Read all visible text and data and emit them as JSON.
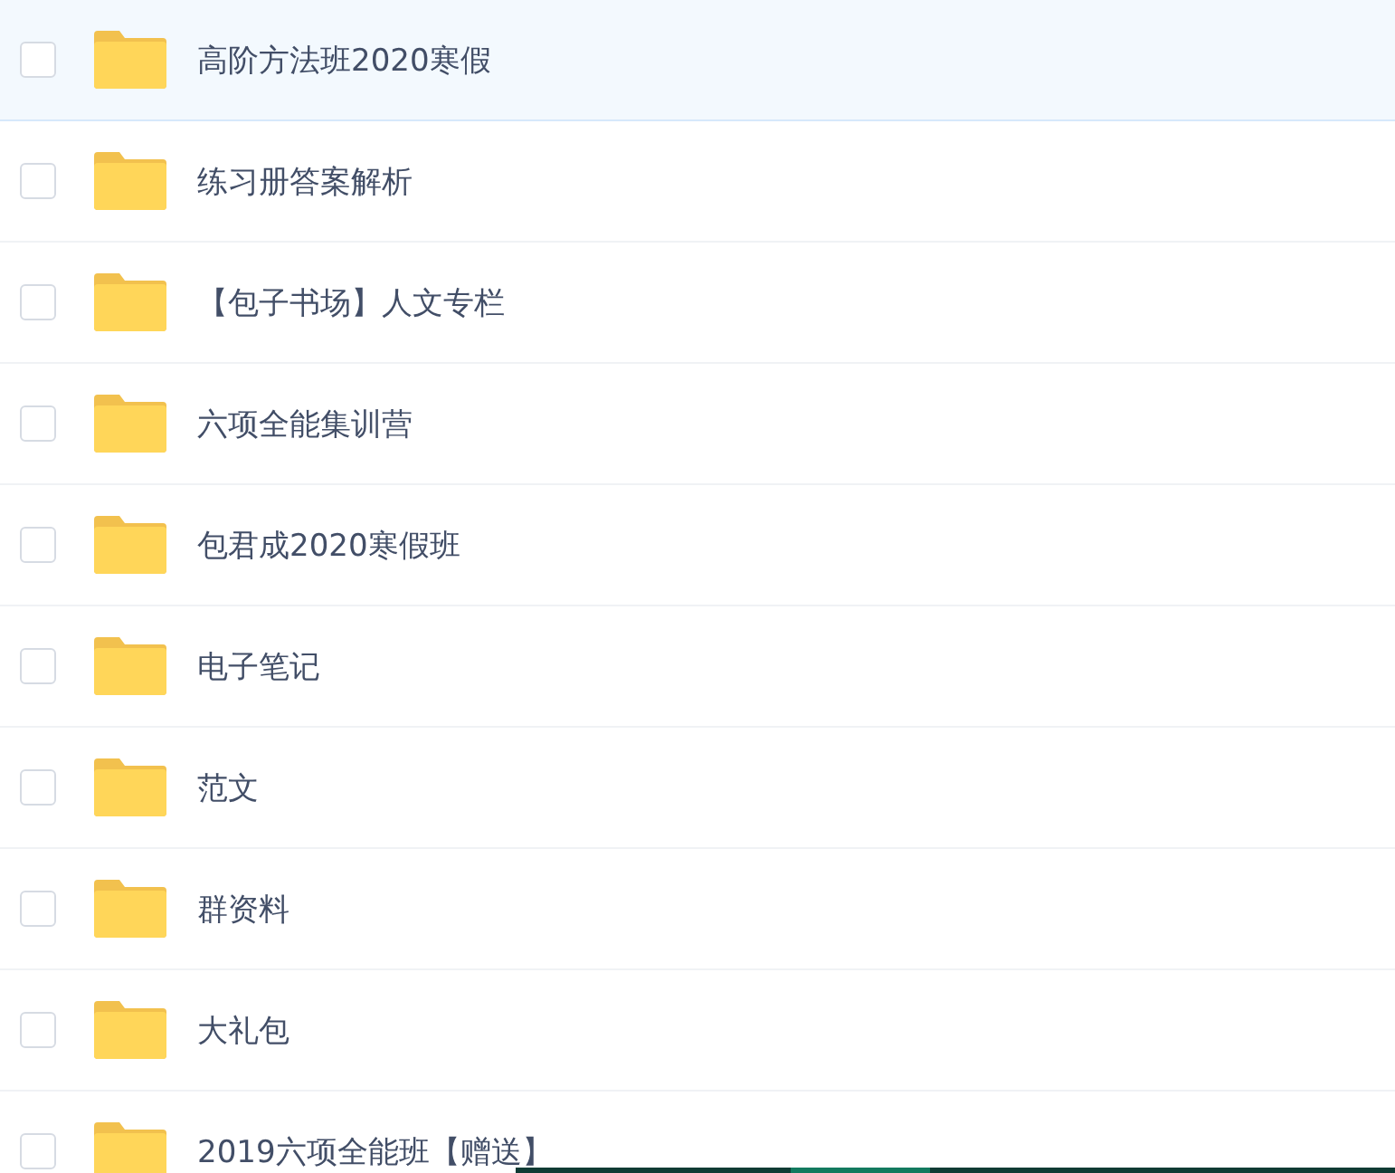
{
  "folders": [
    {
      "name": "高阶方法班2020寒假",
      "selected": true,
      "checked": false
    },
    {
      "name": "练习册答案解析",
      "selected": false,
      "checked": false
    },
    {
      "name": "【包子书场】人文专栏",
      "selected": false,
      "checked": false
    },
    {
      "name": "六项全能集训营",
      "selected": false,
      "checked": false
    },
    {
      "name": "包君成2020寒假班",
      "selected": false,
      "checked": false
    },
    {
      "name": "电子笔记",
      "selected": false,
      "checked": false
    },
    {
      "name": "范文",
      "selected": false,
      "checked": false
    },
    {
      "name": "群资料",
      "selected": false,
      "checked": false
    },
    {
      "name": "大礼包",
      "selected": false,
      "checked": false
    },
    {
      "name": "2019六项全能班【赠送】",
      "selected": false,
      "checked": false
    }
  ]
}
